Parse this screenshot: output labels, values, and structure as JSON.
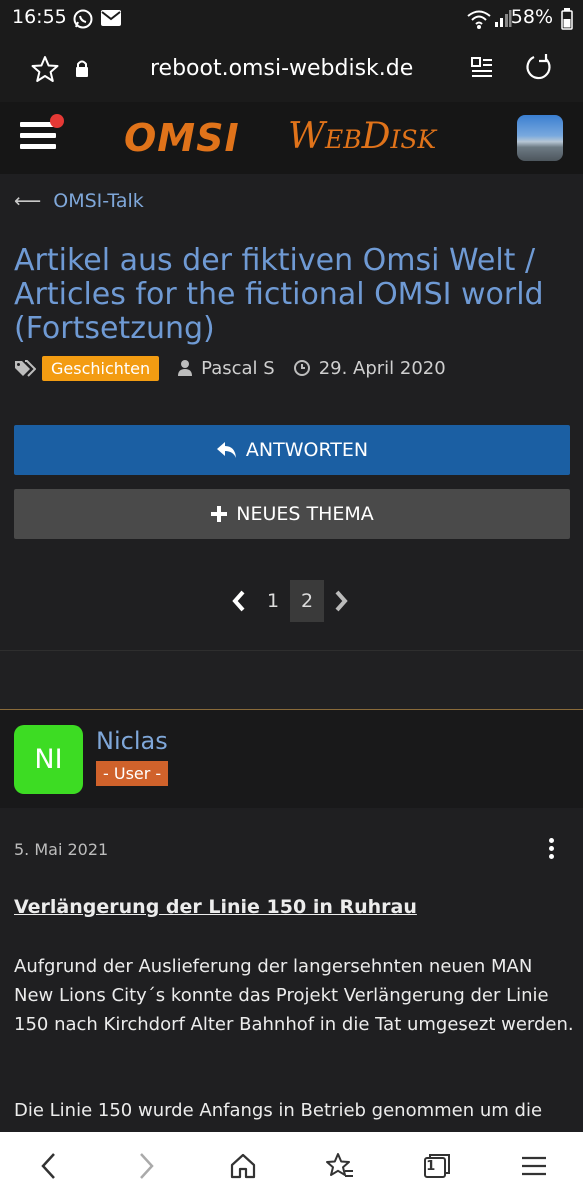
{
  "status_bar": {
    "time": "16:55",
    "battery": "58%",
    "icons": [
      "whatsapp-icon",
      "gmail-icon",
      "wifi-icon",
      "signal-icon",
      "battery-icon"
    ]
  },
  "browser": {
    "url": "reboot.omsi-webdisk.de",
    "icons": [
      "star-icon",
      "lock-icon",
      "reader-icon",
      "reload-icon"
    ]
  },
  "site": {
    "logo_left": "OMSI",
    "logo_right": "WebDisk",
    "accent": "#e0731a"
  },
  "breadcrumb": {
    "label": "OMSI-Talk"
  },
  "thread": {
    "title": "Artikel aus der fiktiven Omsi Welt / Articles for the fictional OMSI world (Fortsetzung)",
    "tag": "Geschichten",
    "author": "Pascal S",
    "date": "29. April 2020"
  },
  "buttons": {
    "reply": "ANTWORTEN",
    "new_topic": "NEUES THEMA"
  },
  "pagination": {
    "pages": [
      "1",
      "2"
    ],
    "current": "2"
  },
  "post": {
    "avatar_initials": "NI",
    "username": "Niclas",
    "role": "- User -",
    "date": "5. Mai 2021",
    "heading": "Verlängerung der Linie 150 in Ruhrau",
    "paragraph1": "Aufgrund der Auslieferung der langersehnten neuen MAN New Lions City´s konnte das Projekt Verlängerung der Linie 150 nach Kirchdorf Alter Bahnhof in die Tat umgesezt werden.",
    "paragraph2": "Die Linie 150 wurde Anfangs in Betrieb genommen um die"
  },
  "bottom_nav": {
    "tab_count": "1",
    "icons": [
      "back-icon",
      "forward-icon",
      "home-icon",
      "bookmarks-icon",
      "tabs-icon",
      "menu-icon"
    ]
  }
}
